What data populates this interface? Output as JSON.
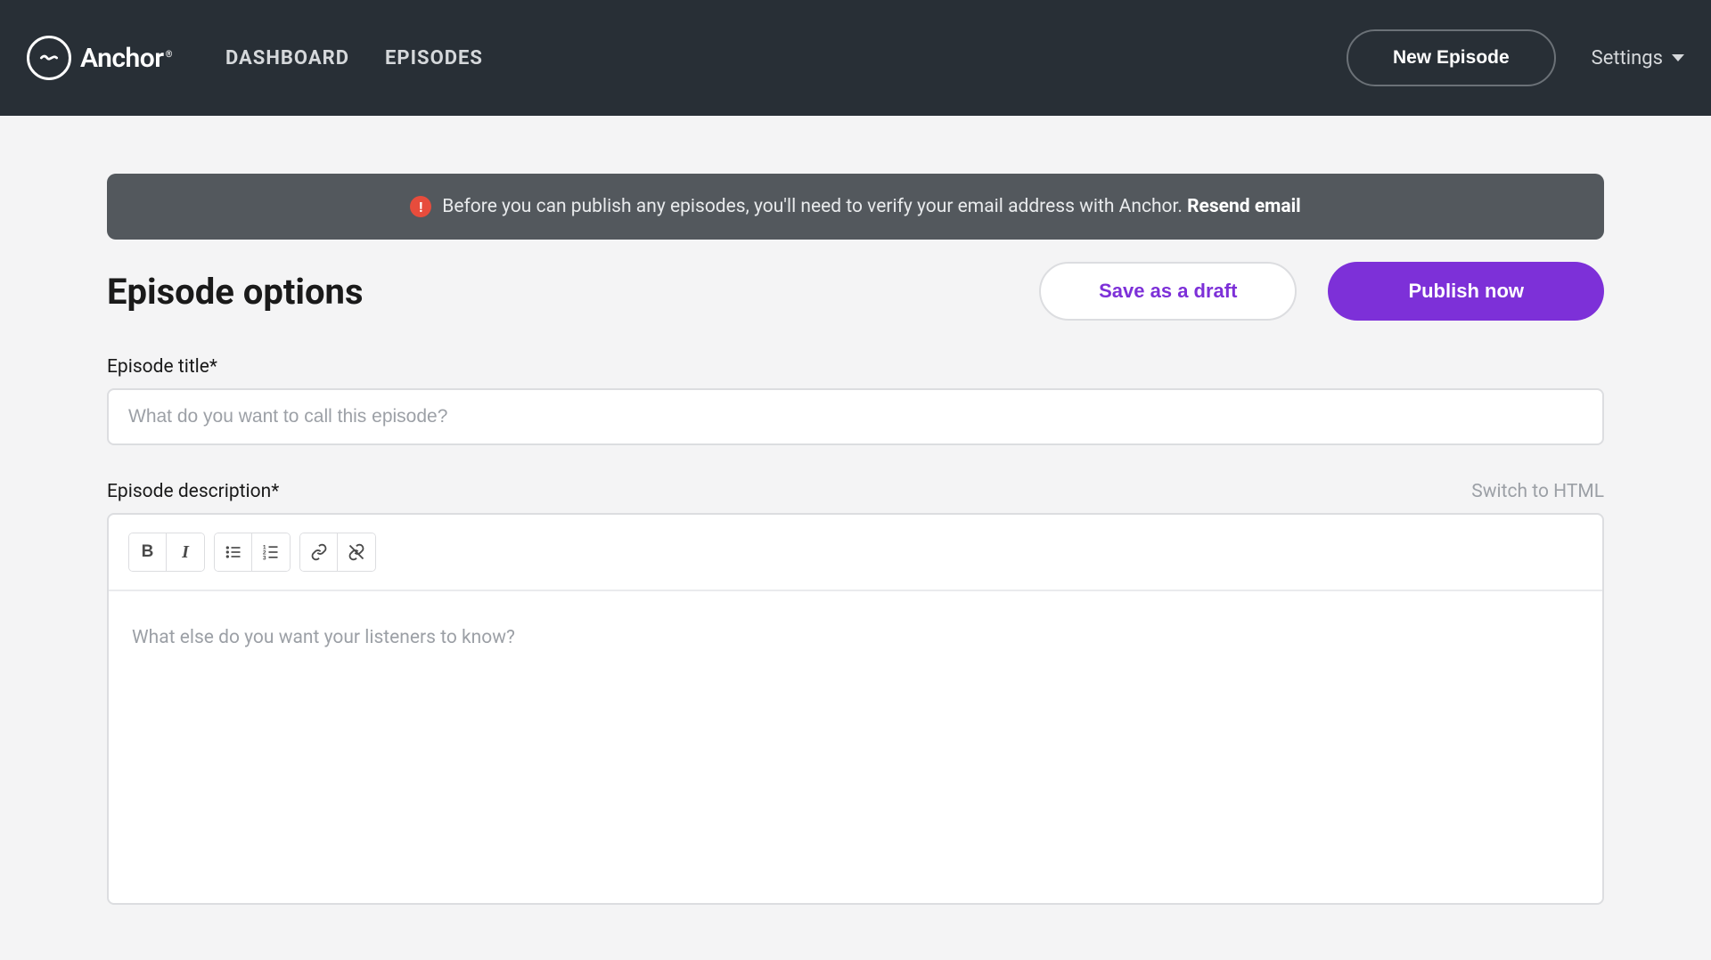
{
  "header": {
    "logo_text": "Anchor",
    "nav": {
      "dashboard": "DASHBOARD",
      "episodes": "EPISODES"
    },
    "new_episode_label": "New Episode",
    "settings_label": "Settings"
  },
  "alert": {
    "icon_symbol": "!",
    "message": "Before you can publish any episodes, you'll need to verify your email address with Anchor. ",
    "link_text": "Resend email"
  },
  "page": {
    "title": "Episode options",
    "save_draft_label": "Save as a draft",
    "publish_label": "Publish now"
  },
  "form": {
    "title_label": "Episode title*",
    "title_placeholder": "What do you want to call this episode?",
    "title_value": "",
    "description_label": "Episode description*",
    "switch_html_label": "Switch to HTML",
    "description_placeholder": "What else do you want your listeners to know?"
  }
}
